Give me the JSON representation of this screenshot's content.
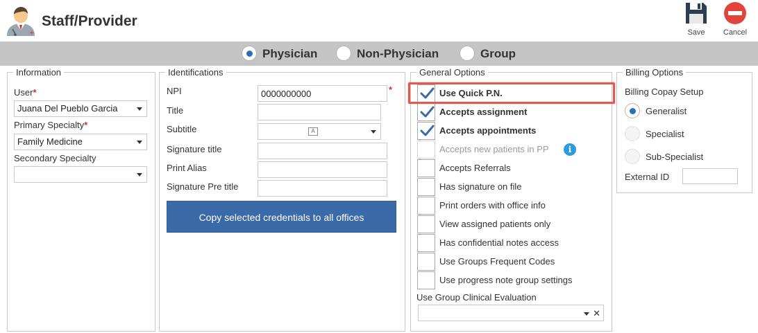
{
  "header": {
    "title": "Staff/Provider",
    "save_label": "Save",
    "cancel_label": "Cancel"
  },
  "type_selector": {
    "options": [
      "Physician",
      "Non-Physician",
      "Group"
    ],
    "selected": "Physician"
  },
  "information": {
    "legend": "Information",
    "user_label": "User",
    "user_value": "Juana Del Pueblo Garcia",
    "primary_specialty_label": "Primary Specialty",
    "primary_specialty_value": "Family Medicine",
    "secondary_specialty_label": "Secondary Specialty",
    "secondary_specialty_value": ""
  },
  "identifications": {
    "legend": "Identifications",
    "npi_label": "NPI",
    "npi_value": "0000000000",
    "title_label": "Title",
    "subtitle_label": "Subtitle",
    "signature_title_label": "Signature title",
    "print_alias_label": "Print Alias",
    "signature_pre_title_label": "Signature Pre title",
    "copy_button_label": "Copy selected credentials to all offices"
  },
  "general_options": {
    "legend": "General Options",
    "items": [
      {
        "label": "Use Quick P.N.",
        "checked": true
      },
      {
        "label": "Accepts assignment",
        "checked": true
      },
      {
        "label": "Accepts appointments",
        "checked": true
      },
      {
        "label": "Accepts new patients in PP",
        "checked": false,
        "disabled": true
      },
      {
        "label": "Accepts Referrals",
        "checked": false
      },
      {
        "label": "Has signature on file",
        "checked": false
      },
      {
        "label": "Print orders with office info",
        "checked": false
      },
      {
        "label": "View assigned patients only",
        "checked": false
      },
      {
        "label": "Has confidential notes access",
        "checked": false
      },
      {
        "label": "Use Groups Frequent Codes",
        "checked": false
      },
      {
        "label": "Use progress note group settings",
        "checked": false
      }
    ],
    "group_clinical_eval_label": "Use Group Clinical Evaluation",
    "group_clinical_eval_value": ""
  },
  "billing_options": {
    "legend": "Billing Options",
    "copay_setup_label": "Billing Copay Setup",
    "copay_options": [
      "Generalist",
      "Specialist",
      "Sub-Specialist"
    ],
    "copay_selected": "Generalist",
    "external_id_label": "External ID",
    "external_id_value": ""
  },
  "colors": {
    "accent": "#2f6db5",
    "copy_button": "#3a6aa8",
    "highlight": "#e05a4f",
    "type_bar": "#c5c5c5",
    "required": "#c0392b"
  },
  "icons": {
    "app": "doctor-avatar-icon",
    "save": "floppy-disk-icon",
    "cancel": "no-entry-icon",
    "info": "info-icon"
  }
}
